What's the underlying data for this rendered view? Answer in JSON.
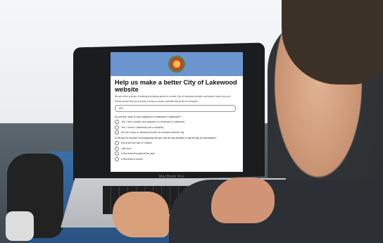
{
  "form": {
    "title": "Help us make a better City of Lakewood website",
    "intro": "We are in the process of building and testing plans for a better City of Lakewood website, and want to hear from you!",
    "instruction": "Please answer this short survey to help us create a website that works for everyone.",
    "progress_label": "0%",
    "progress_fraction": 0,
    "questions": [
      {
        "text": "Do you live, work or own property or a business in Lakewood? *",
        "options": [
          "Yes, I live in and/or own property or a business in Lakewood",
          "Yes, I work in Lakewood (not a resident)",
          "No, but I shop in Lakewood and/or do business with the city"
        ]
      },
      {
        "text": "In the last 12 months, how frequently did you visit the city website or call the city for information?",
        "options": [
          "Not at all over last 12 months",
          "Just once",
          "A few times throughout the year",
          "A few times a month"
        ]
      }
    ]
  },
  "laptop": {
    "brand": "MacBook Pro"
  },
  "colors": {
    "header": "#6c95d0",
    "cushion": "#2e9fc4"
  },
  "icons": {
    "logo": "city-seal-icon"
  }
}
